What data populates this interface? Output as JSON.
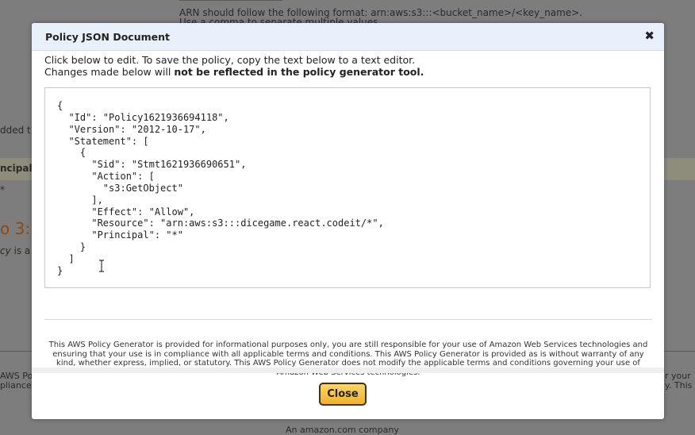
{
  "background": {
    "arn_hint_line1": "ARN should follow the following format: arn:aws:s3:::<bucket_name>/<key_name>.",
    "arn_hint_line2": "Use a comma to separate multiple values.",
    "added_fragment": "dded t",
    "principal_fragment": "ncipal",
    "star_fragment": "*",
    "step_fragment": "o 3:",
    "policy_fragment_italic": "cy",
    "policy_fragment_rest": " is a",
    "aws_po_fragment": "AWS Po",
    "pliance_fragment": "pliance",
    "right_fragment1": "r your",
    "right_fragment2": "y. This A",
    "footer_fragment": "An amazon.com company"
  },
  "modal": {
    "title": "Policy JSON Document",
    "close_icon": "close-x-icon",
    "instruction_line1": "Click below to edit. To save the policy, copy the text below to a text editor.",
    "instruction_line2_prefix": "Changes made below will ",
    "instruction_line2_bold": "not be reflected in the policy generator tool.",
    "policy_json": "{\n  \"Id\": \"Policy1621936694118\",\n  \"Version\": \"2012-10-17\",\n  \"Statement\": [\n    {\n      \"Sid\": \"Stmt1621936690651\",\n      \"Action\": [\n        \"s3:GetObject\"\n      ],\n      \"Effect\": \"Allow\",\n      \"Resource\": \"arn:aws:s3:::dicegame.react.codeit/*\",\n      \"Principal\": \"*\"\n    }\n  ]\n}",
    "disclaimer": "This AWS Policy Generator is provided for informational purposes only, you are still responsible for your use of Amazon Web Services technologies and ensuring that your use is in compliance with all applicable terms and conditions. This AWS Policy Generator is provided as is without warranty of any kind, whether express, implied, or statutory. This AWS Policy Generator does not modify the applicable terms and conditions governing your use of Amazon Web Services technologies.",
    "close_button_label": "Close"
  },
  "colors": {
    "header_bg": "#e8f1fb",
    "button_bg": "#f0b22a",
    "overlay": "#7d7d7d"
  }
}
